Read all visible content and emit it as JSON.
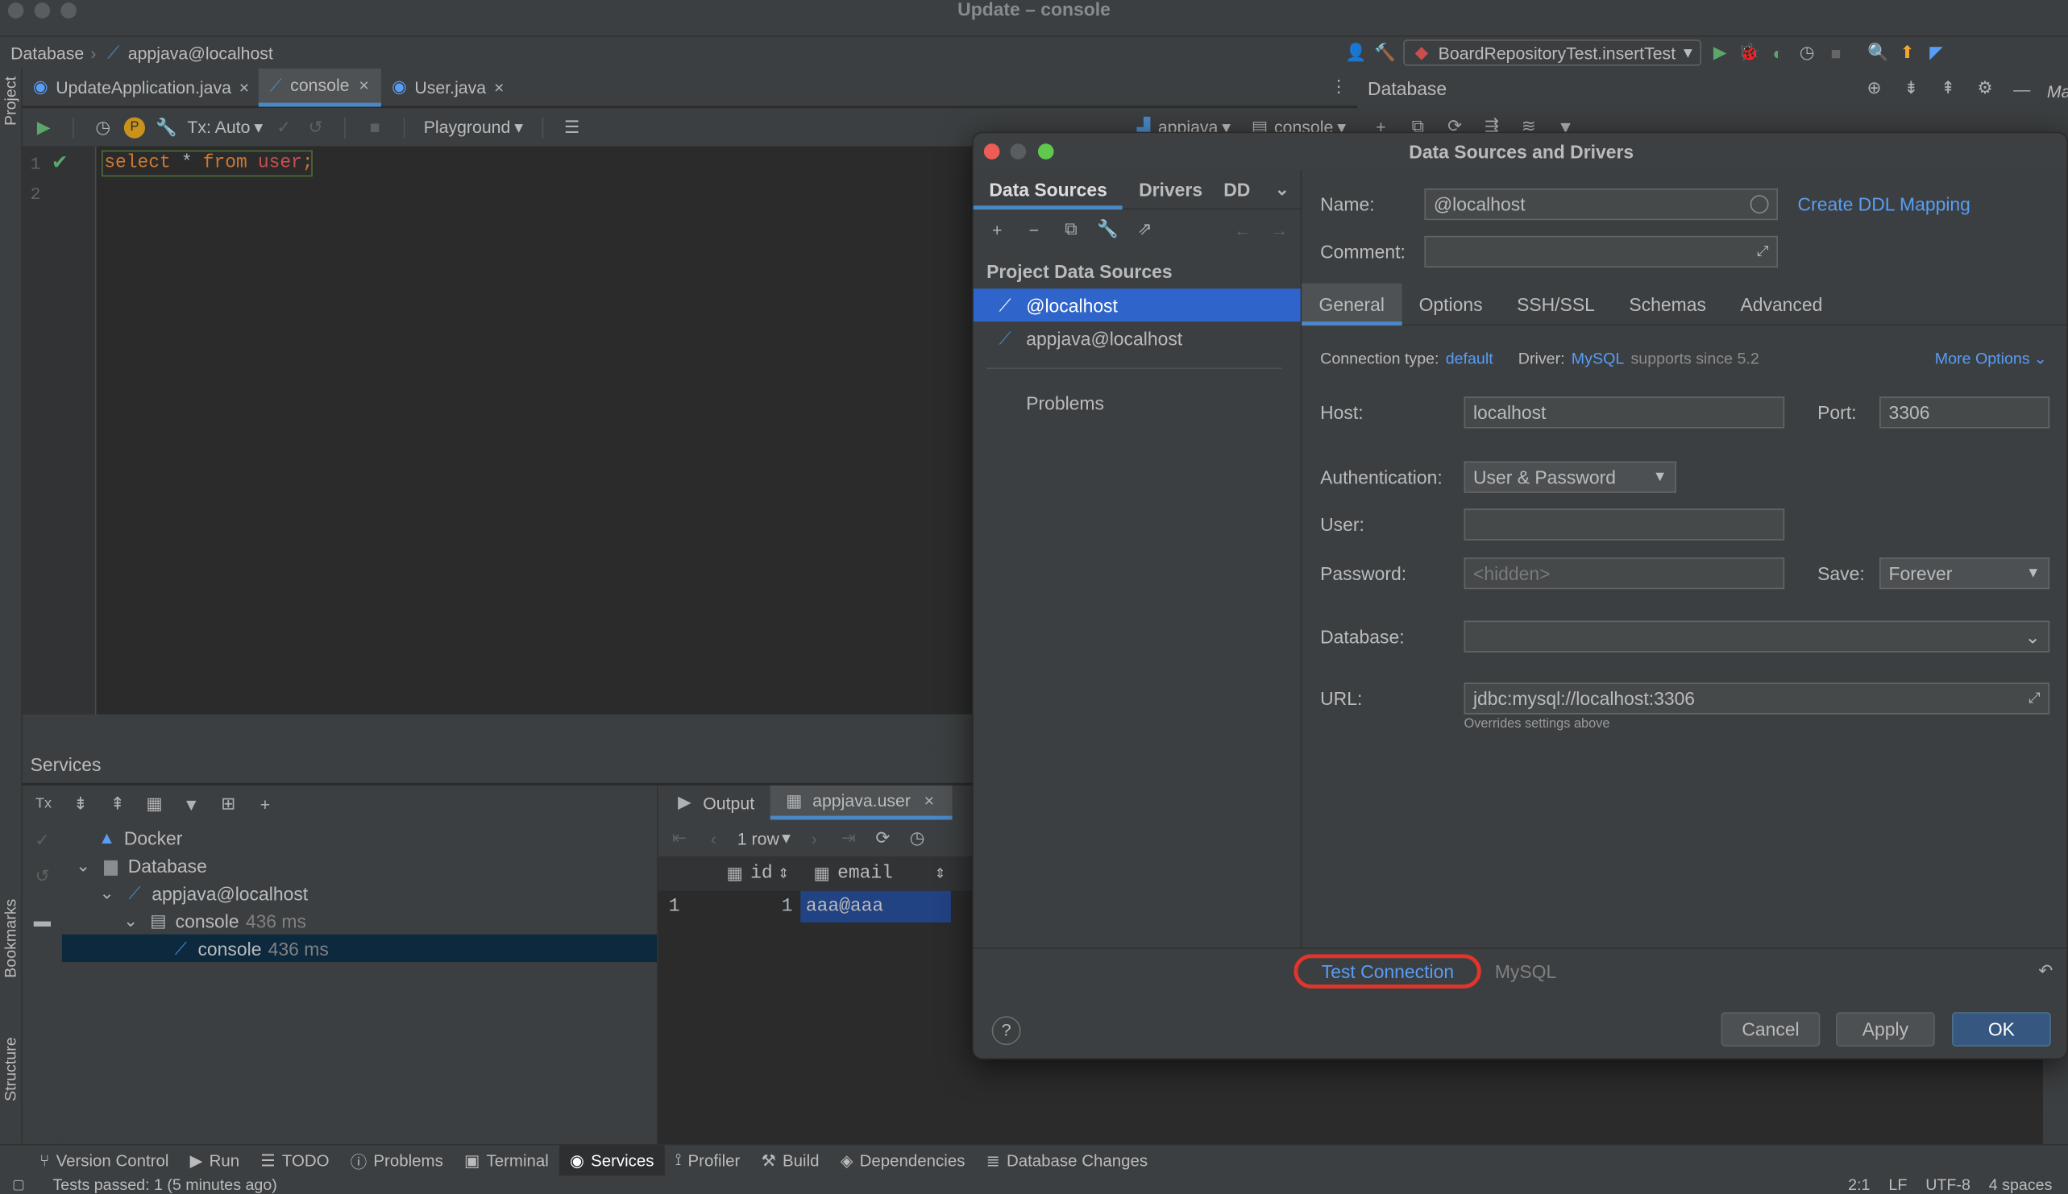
{
  "window": {
    "title": "Update – console"
  },
  "navbar": {
    "crumb1": "Database",
    "crumb2": "appjava@localhost",
    "run_config": "BoardRepositoryTest.insertTest"
  },
  "left_strip": {
    "project": "Project",
    "bookmarks": "Bookmarks",
    "structure": "Structure"
  },
  "right_strip": {
    "label": "Ma"
  },
  "editor_tabs": [
    {
      "label": "UpdateApplication.java"
    },
    {
      "label": "console"
    },
    {
      "label": "User.java"
    }
  ],
  "editor_toolbar": {
    "tx": "Tx: Auto",
    "playground": "Playground",
    "schema": "appjava",
    "console": "console"
  },
  "editor": {
    "line1_no": "1",
    "line2_no": "2",
    "code": {
      "kw1": "select",
      "star": "*",
      "kw2": "from",
      "ident": "user",
      "semi": ";"
    }
  },
  "services": {
    "title": "Services",
    "tree": [
      {
        "label": "Docker",
        "meta": ""
      },
      {
        "label": "Database",
        "meta": ""
      },
      {
        "label": "appjava@localhost",
        "meta": ""
      },
      {
        "label": "console",
        "meta": "436 ms"
      },
      {
        "label": "console",
        "meta": "436 ms"
      }
    ],
    "result_tabs": {
      "output": "Output",
      "table": "appjava.user"
    },
    "rows_label": "1 row",
    "columns": [
      "id",
      "email"
    ],
    "rows": [
      {
        "num": "1",
        "id": "1",
        "email": "aaa@aaa"
      }
    ]
  },
  "database_panel": {
    "title": "Database"
  },
  "dialog": {
    "title": "Data Sources and Drivers",
    "left_tabs": {
      "data_sources": "Data Sources",
      "drivers": "Drivers",
      "ddl": "DD"
    },
    "section": "Project Data Sources",
    "sources": [
      {
        "label": "@localhost",
        "selected": true
      },
      {
        "label": "appjava@localhost",
        "selected": false
      }
    ],
    "problems": "Problems",
    "name_label": "Name:",
    "name_value": "@localhost",
    "create_ddl": "Create DDL Mapping",
    "comment_label": "Comment:",
    "tabs": [
      "General",
      "Options",
      "SSH/SSL",
      "Schemas",
      "Advanced"
    ],
    "conn_type_label": "Connection type:",
    "conn_type_value": "default",
    "driver_label": "Driver:",
    "driver_value": "MySQL",
    "driver_note": "supports since 5.2",
    "more_options": "More Options",
    "host_label": "Host:",
    "host_value": "localhost",
    "port_label": "Port:",
    "port_value": "3306",
    "auth_label": "Authentication:",
    "auth_value": "User & Password",
    "user_label": "User:",
    "password_label": "Password:",
    "password_placeholder": "<hidden>",
    "save_label": "Save:",
    "save_value": "Forever",
    "database_label": "Database:",
    "url_label": "URL:",
    "url_value": "jdbc:mysql://localhost:3306",
    "url_note": "Overrides settings above",
    "test_connection": "Test Connection",
    "driver_footer": "MySQL",
    "help": "?",
    "cancel": "Cancel",
    "apply": "Apply",
    "ok": "OK",
    "highlight_color": "#e0352b"
  },
  "bottom_tabs": [
    "Version Control",
    "Run",
    "TODO",
    "Problems",
    "Terminal",
    "Services",
    "Profiler",
    "Build",
    "Dependencies",
    "Database Changes"
  ],
  "status": {
    "message": "Tests passed: 1 (5 minutes ago)",
    "position": "2:1",
    "line_sep": "LF",
    "encoding": "UTF-8",
    "indent": "4 spaces"
  }
}
